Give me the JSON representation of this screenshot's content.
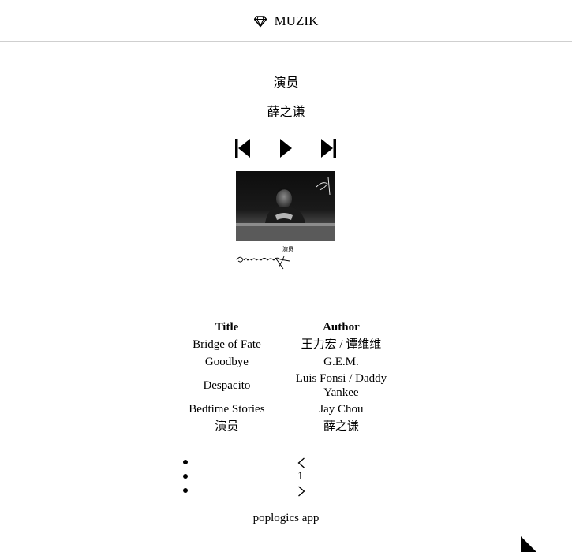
{
  "app": {
    "brand_name": "MUZIK",
    "brand_icon": "diamond-icon"
  },
  "now_playing": {
    "title": "演员",
    "artist": "薛之谦",
    "controls": {
      "prev_icon": "skip-previous-icon",
      "play_icon": "play-icon",
      "next_icon": "skip-next-icon"
    },
    "cover": {
      "alt": "album-cover",
      "caption_main": "演员",
      "signature": "Gentleman"
    }
  },
  "playlist": {
    "headers": {
      "title": "Title",
      "author": "Author"
    },
    "rows": [
      {
        "title": "Bridge of Fate",
        "author": "王力宏 / 谭维维"
      },
      {
        "title": "Goodbye",
        "author": "G.E.M."
      },
      {
        "title": "Despacito",
        "author": "Luis Fonsi / Daddy Yankee"
      },
      {
        "title": "Bedtime Stories",
        "author": "Jay Chou"
      },
      {
        "title": "演员",
        "author": "薛之谦"
      }
    ]
  },
  "pagination": {
    "prev_icon": "chevron-left-icon",
    "current_page": "1",
    "next_icon": "chevron-right-icon"
  },
  "footer": {
    "text": "poplogics app"
  },
  "colors": {
    "header_border": "#cfcfcf",
    "text": "#000000",
    "background": "#ffffff"
  }
}
